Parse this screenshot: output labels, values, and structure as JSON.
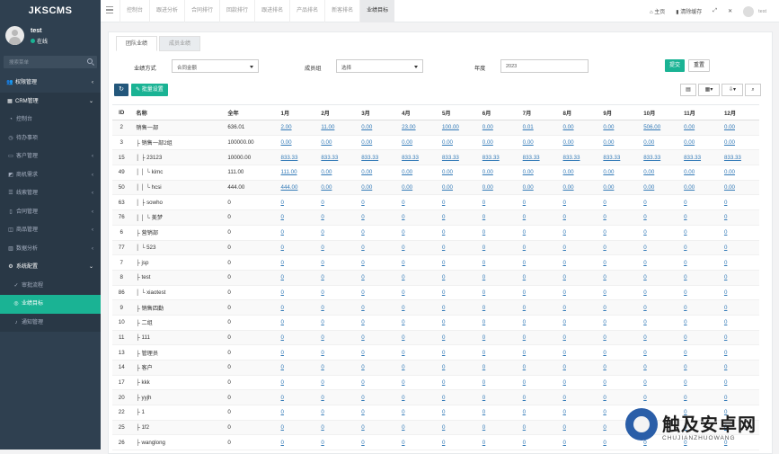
{
  "app": {
    "brand": "JKSCMS"
  },
  "user": {
    "name": "test",
    "status": "在线"
  },
  "sidebar": {
    "search_placeholder": "搜索菜单",
    "items": [
      {
        "label": "权限管理",
        "icon": "users-icon",
        "level": "top",
        "state": ""
      },
      {
        "label": "CRM管理",
        "icon": "grid-icon",
        "level": "top",
        "state": "open"
      },
      {
        "label": "控制台",
        "icon": "dashboard-icon",
        "level": "sub",
        "state": ""
      },
      {
        "label": "待办事项",
        "icon": "clock-icon",
        "level": "sub",
        "state": ""
      },
      {
        "label": "客户管理",
        "icon": "folder-icon",
        "level": "sub",
        "state": ""
      },
      {
        "label": "商机需求",
        "icon": "chart-icon",
        "level": "sub",
        "state": ""
      },
      {
        "label": "线索管理",
        "icon": "list-icon",
        "level": "sub",
        "state": ""
      },
      {
        "label": "合同管理",
        "icon": "file-icon",
        "level": "sub",
        "state": ""
      },
      {
        "label": "商品管理",
        "icon": "box-icon",
        "level": "sub",
        "state": ""
      },
      {
        "label": "数据分析",
        "icon": "bar-icon",
        "level": "sub",
        "state": ""
      },
      {
        "label": "系统配置",
        "icon": "gear-icon",
        "level": "sub",
        "state": "open"
      },
      {
        "label": "审批流程",
        "icon": "approve-icon",
        "level": "sub2",
        "state": ""
      },
      {
        "label": "业绩目标",
        "icon": "target-icon",
        "level": "sub2",
        "state": "active"
      },
      {
        "label": "通知管理",
        "icon": "bell-icon",
        "level": "sub2",
        "state": ""
      }
    ]
  },
  "topbar": {
    "tabs": [
      "控制台",
      "跟进分析",
      "合同排行",
      "回款排行",
      "跟进排名",
      "产品排名",
      "新客排名",
      "业绩目标"
    ],
    "active_tab": 7,
    "home_label": "主页",
    "clear_cache_label": "清除缓存",
    "user_label": "test"
  },
  "panel": {
    "tabs": [
      "团队业绩",
      "成员业绩"
    ],
    "active_tab": 0,
    "filters": {
      "method_label": "业绩方式",
      "method_value": "合同金额",
      "member_label": "成员组",
      "member_value": "选择",
      "year_label": "年度",
      "year_value": "2023",
      "submit_label": "提交",
      "reset_label": "重置"
    },
    "batch_label": "批量设置"
  },
  "table": {
    "headers": [
      "ID",
      "名称",
      "全年",
      "1月",
      "2月",
      "3月",
      "4月",
      "5月",
      "6月",
      "7月",
      "8月",
      "9月",
      "10月",
      "11月",
      "12月"
    ],
    "rows": [
      {
        "id": "2",
        "name": "销售一部",
        "year": "636.01",
        "m": [
          "2.00",
          "11.00",
          "0.00",
          "23.00",
          "100.00",
          "0.00",
          "0.01",
          "0.00",
          "0.00",
          "506.00",
          "0.00",
          "0.00"
        ]
      },
      {
        "id": "3",
        "name": "├ 销售一部2组",
        "year": "100000.00",
        "m": [
          "0.00",
          "0.00",
          "0.00",
          "0.00",
          "0.00",
          "0.00",
          "0.00",
          "0.00",
          "0.00",
          "0.00",
          "0.00",
          "0.00"
        ]
      },
      {
        "id": "15",
        "name": "│ ├ 23123",
        "year": "10000.00",
        "m": [
          "833.33",
          "833.33",
          "833.33",
          "833.33",
          "833.33",
          "833.33",
          "833.33",
          "833.33",
          "833.33",
          "833.33",
          "833.33",
          "833.33"
        ]
      },
      {
        "id": "49",
        "name": "│ │ └ kimc",
        "year": "111.00",
        "m": [
          "111.00",
          "0.00",
          "0.00",
          "0.00",
          "0.00",
          "0.00",
          "0.00",
          "0.00",
          "0.00",
          "0.00",
          "0.00",
          "0.00"
        ]
      },
      {
        "id": "50",
        "name": "│ │ └ hcsi",
        "year": "444.00",
        "m": [
          "444.00",
          "0.00",
          "0.00",
          "0.00",
          "0.00",
          "0.00",
          "0.00",
          "0.00",
          "0.00",
          "0.00",
          "0.00",
          "0.00"
        ]
      },
      {
        "id": "63",
        "name": "│ ├ sowho",
        "year": "0",
        "m": [
          "0",
          "0",
          "0",
          "0",
          "0",
          "0",
          "0",
          "0",
          "0",
          "0",
          "0",
          "0"
        ]
      },
      {
        "id": "76",
        "name": "│ │ └ 美梦",
        "year": "0",
        "m": [
          "0",
          "0",
          "0",
          "0",
          "0",
          "0",
          "0",
          "0",
          "0",
          "0",
          "0",
          "0"
        ]
      },
      {
        "id": "6",
        "name": "├ 营销部",
        "year": "0",
        "m": [
          "0",
          "0",
          "0",
          "0",
          "0",
          "0",
          "0",
          "0",
          "0",
          "0",
          "0",
          "0"
        ]
      },
      {
        "id": "77",
        "name": "│ └ 523",
        "year": "0",
        "m": [
          "0",
          "0",
          "0",
          "0",
          "0",
          "0",
          "0",
          "0",
          "0",
          "0",
          "0",
          "0"
        ]
      },
      {
        "id": "7",
        "name": "├ jsp",
        "year": "0",
        "m": [
          "0",
          "0",
          "0",
          "0",
          "0",
          "0",
          "0",
          "0",
          "0",
          "0",
          "0",
          "0"
        ]
      },
      {
        "id": "8",
        "name": "├ test",
        "year": "0",
        "m": [
          "0",
          "0",
          "0",
          "0",
          "0",
          "0",
          "0",
          "0",
          "0",
          "0",
          "0",
          "0"
        ]
      },
      {
        "id": "86",
        "name": "│ └ xiaotest",
        "year": "0",
        "m": [
          "0",
          "0",
          "0",
          "0",
          "0",
          "0",
          "0",
          "0",
          "0",
          "0",
          "0",
          "0"
        ]
      },
      {
        "id": "9",
        "name": "├ 销售四勤",
        "year": "0",
        "m": [
          "0",
          "0",
          "0",
          "0",
          "0",
          "0",
          "0",
          "0",
          "0",
          "0",
          "0",
          "0"
        ]
      },
      {
        "id": "10",
        "name": "├ 二组",
        "year": "0",
        "m": [
          "0",
          "0",
          "0",
          "0",
          "0",
          "0",
          "0",
          "0",
          "0",
          "0",
          "0",
          "0"
        ]
      },
      {
        "id": "11",
        "name": "├ 111",
        "year": "0",
        "m": [
          "0",
          "0",
          "0",
          "0",
          "0",
          "0",
          "0",
          "0",
          "0",
          "0",
          "0",
          "0"
        ]
      },
      {
        "id": "13",
        "name": "├ 管理员",
        "year": "0",
        "m": [
          "0",
          "0",
          "0",
          "0",
          "0",
          "0",
          "0",
          "0",
          "0",
          "0",
          "0",
          "0"
        ]
      },
      {
        "id": "14",
        "name": "├ 客户",
        "year": "0",
        "m": [
          "0",
          "0",
          "0",
          "0",
          "0",
          "0",
          "0",
          "0",
          "0",
          "0",
          "0",
          "0"
        ]
      },
      {
        "id": "17",
        "name": "├ kkk",
        "year": "0",
        "m": [
          "0",
          "0",
          "0",
          "0",
          "0",
          "0",
          "0",
          "0",
          "0",
          "0",
          "0",
          "0"
        ]
      },
      {
        "id": "20",
        "name": "├ yyjh",
        "year": "0",
        "m": [
          "0",
          "0",
          "0",
          "0",
          "0",
          "0",
          "0",
          "0",
          "0",
          "0",
          "0",
          "0"
        ]
      },
      {
        "id": "22",
        "name": "├ 1",
        "year": "0",
        "m": [
          "0",
          "0",
          "0",
          "0",
          "0",
          "0",
          "0",
          "0",
          "0",
          "0",
          "0",
          "0"
        ]
      },
      {
        "id": "25",
        "name": "├ 1f2",
        "year": "0",
        "m": [
          "0",
          "0",
          "0",
          "0",
          "0",
          "0",
          "0",
          "0",
          "0",
          "0",
          "0",
          "0"
        ]
      },
      {
        "id": "26",
        "name": "├ wanglong",
        "year": "0",
        "m": [
          "0",
          "0",
          "0",
          "0",
          "0",
          "0",
          "0",
          "0",
          "0",
          "0",
          "0",
          "0"
        ]
      }
    ]
  },
  "watermark": {
    "title": "触及安卓网",
    "subtitle": "CHUJIANZHUOWANG"
  }
}
